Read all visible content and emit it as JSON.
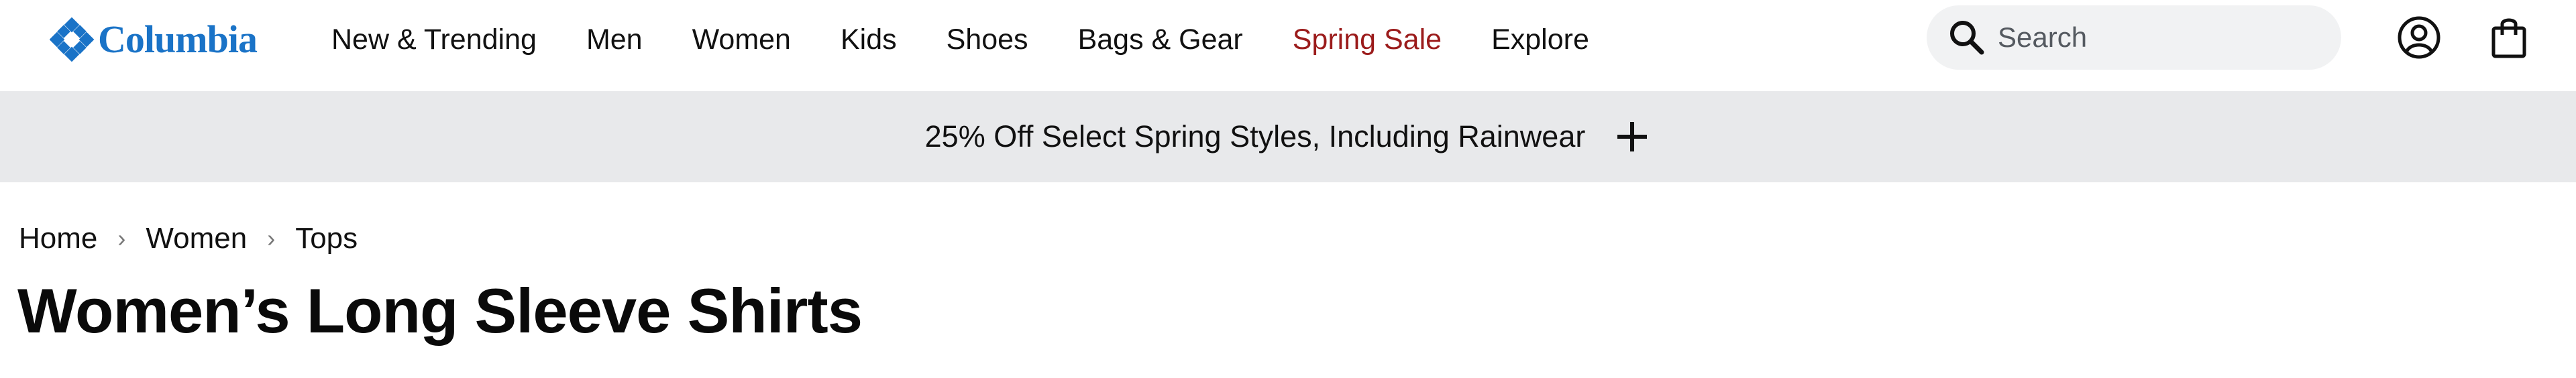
{
  "header": {
    "logo_text": "Columbia",
    "brand_color": "#1a73c7",
    "nav": [
      {
        "label": "New & Trending"
      },
      {
        "label": "Men"
      },
      {
        "label": "Women"
      },
      {
        "label": "Kids"
      },
      {
        "label": "Shoes"
      },
      {
        "label": "Bags & Gear"
      },
      {
        "label": "Spring Sale",
        "color": "#9b1b1b"
      },
      {
        "label": "Explore"
      }
    ],
    "search": {
      "placeholder": "Search",
      "value": "",
      "icon": "search-icon"
    },
    "account_icon": "account-icon",
    "cart_icon": "shopping-bag-icon"
  },
  "promo_banner": {
    "text": "25% Off Select Spring Styles, Including Rainwear",
    "toggle_icon": "plus-icon",
    "background": "#e8e9eb"
  },
  "breadcrumb": {
    "items": [
      "Home",
      "Women",
      "Tops"
    ],
    "separator": "›"
  },
  "page": {
    "title": "Women’s Long Sleeve Shirts"
  }
}
